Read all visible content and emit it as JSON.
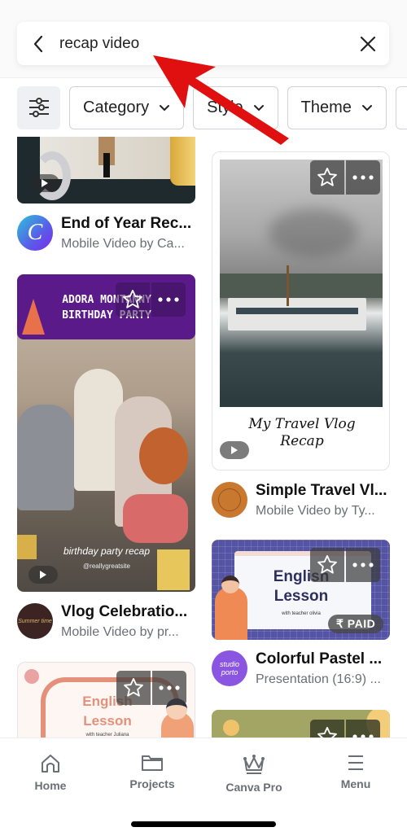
{
  "search": {
    "query": "recap video",
    "back_icon": "chevron-left-icon",
    "clear_icon": "close-icon"
  },
  "filters": {
    "settings_icon": "sliders-icon",
    "chips": [
      {
        "label": "Category"
      },
      {
        "label": "Style"
      },
      {
        "label": "Theme"
      }
    ]
  },
  "results": [
    {
      "title": "End of Year Rec...",
      "subtitle": "Mobile Video by Ca...",
      "avatar_letter": "C",
      "type": "video"
    },
    {
      "title": "Simple Travel Vl...",
      "subtitle": "Mobile Video by Ty...",
      "thumb_text": "My Travel Vlog Recap",
      "type": "video"
    },
    {
      "title": "Vlog Celebratio...",
      "subtitle": "Mobile Video by pr...",
      "thumb_heading": "ADORA MONTANNY BIRTHDAY PARTY",
      "thumb_caption": "birthday party recap",
      "thumb_handle": "@reallygreatsite",
      "avatar_text": "Summer time",
      "type": "video"
    },
    {
      "title": "Colorful Pastel ...",
      "subtitle": "Presentation (16:9) ...",
      "thumb_heading": "English Lesson",
      "thumb_caption": "with teacher olivia",
      "badge": "₹ PAID",
      "avatar_text": "studio porto",
      "type": "presentation"
    },
    {
      "thumb_heading": "English Lesson",
      "thumb_caption": "with teacher Juliana",
      "type": "presentation"
    },
    {
      "type": "presentation"
    }
  ],
  "bottom_nav": [
    {
      "label": "Home",
      "icon": "home-icon"
    },
    {
      "label": "Projects",
      "icon": "folder-icon"
    },
    {
      "label": "Canva Pro",
      "icon": "crown-icon"
    },
    {
      "label": "Menu",
      "icon": "menu-icon"
    }
  ],
  "colors": {
    "annotation_arrow": "#e01010",
    "birthday_purple": "#5a1a8a",
    "lesson_blue": "#5553a3",
    "canva_gradient_start": "#2bc4d8",
    "canva_gradient_end": "#7d2ae8"
  }
}
